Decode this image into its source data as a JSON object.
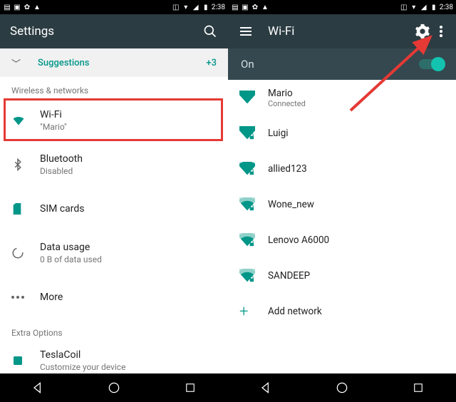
{
  "status": {
    "time": "2:38"
  },
  "left": {
    "title": "Settings",
    "suggestions": {
      "label": "Suggestions",
      "count": "+3"
    },
    "section1": "Wireless & networks",
    "items": [
      {
        "title": "Wi-Fi",
        "sub": "\"Mario\""
      },
      {
        "title": "Bluetooth",
        "sub": "Disabled"
      },
      {
        "title": "SIM cards",
        "sub": ""
      },
      {
        "title": "Data usage",
        "sub": "0 B of data used"
      },
      {
        "title": "More",
        "sub": ""
      }
    ],
    "section2": "Extra Options",
    "extra": {
      "title": "TeslaCoil",
      "sub": "Customize your device"
    }
  },
  "right": {
    "title": "Wi-Fi",
    "state": "On",
    "networks": [
      {
        "name": "Mario",
        "sub": "Connected",
        "lock": false,
        "strength": 4
      },
      {
        "name": "Luigi",
        "sub": "",
        "lock": true,
        "strength": 4
      },
      {
        "name": "allied123",
        "sub": "",
        "lock": true,
        "strength": 3
      },
      {
        "name": "Wone_new",
        "sub": "",
        "lock": true,
        "strength": 2
      },
      {
        "name": "Lenovo A6000",
        "sub": "",
        "lock": true,
        "strength": 2
      },
      {
        "name": "SANDEEP",
        "sub": "",
        "lock": true,
        "strength": 2
      }
    ],
    "add": "Add network"
  }
}
